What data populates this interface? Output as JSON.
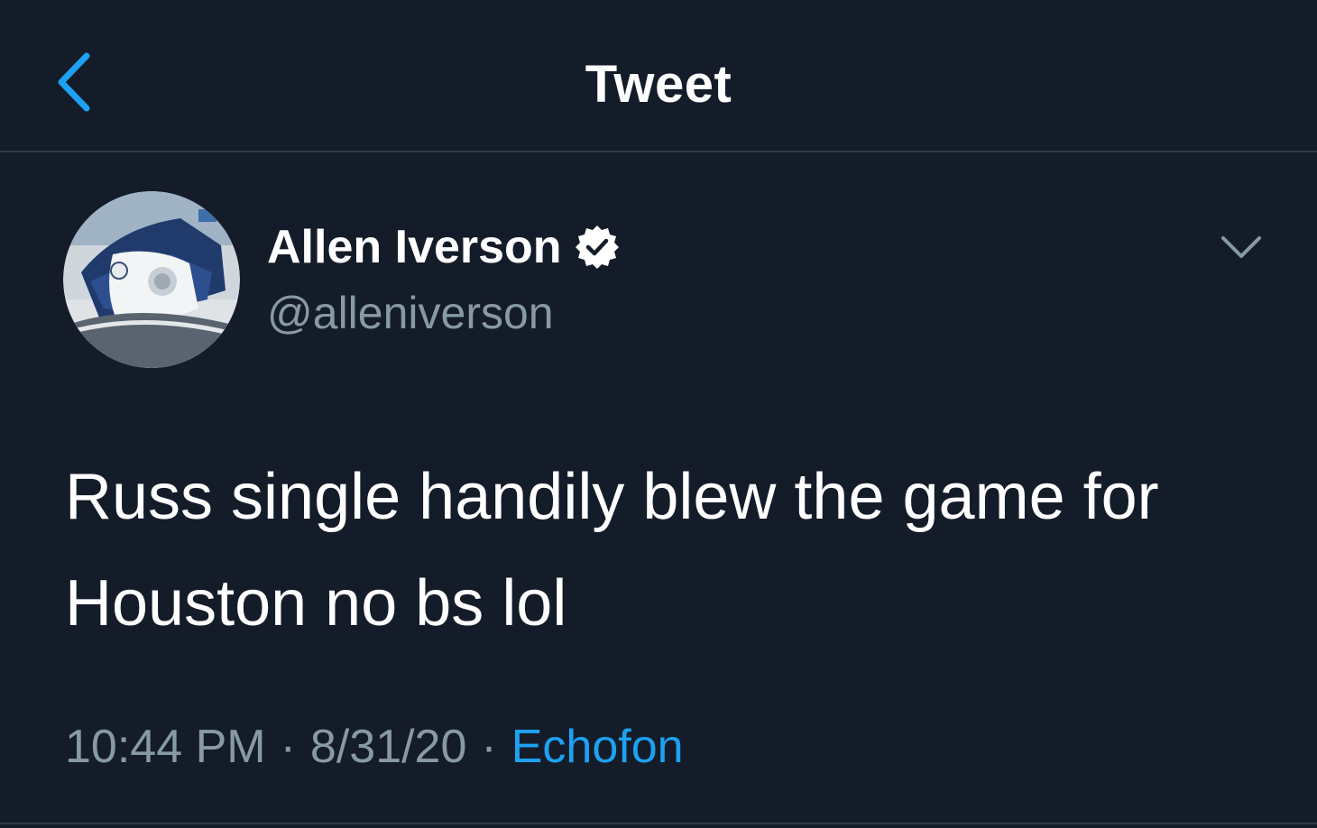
{
  "header": {
    "title": "Tweet",
    "back_icon": "chevron-left-icon"
  },
  "tweet": {
    "author": {
      "name": "Allen Iverson",
      "handle": "@alleniverson",
      "verified": true,
      "verified_icon": "verified-badge-icon",
      "avatar": "avatar-sneaker-image"
    },
    "menu_icon": "chevron-down-icon",
    "text_lines": [
      "Russ single handily blew the game for",
      "Houston no bs lol"
    ],
    "time": "10:44 PM",
    "date": "8/31/20",
    "separator": "·",
    "source": "Echofon"
  },
  "colors": {
    "background": "#151c29",
    "accent": "#1da1f2",
    "secondary_text": "#8899a6",
    "divider": "#2f3845"
  }
}
